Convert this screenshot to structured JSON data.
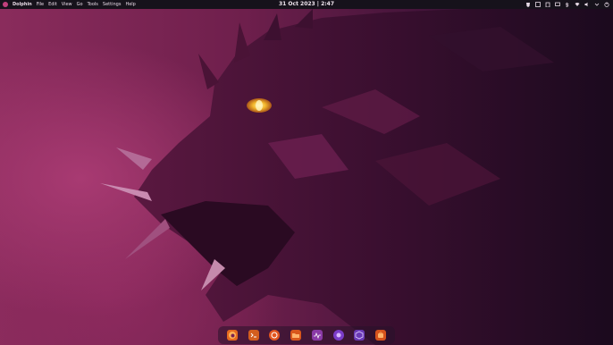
{
  "panel": {
    "app_name": "Dolphin",
    "menu": [
      "File",
      "Edit",
      "View",
      "Go",
      "Tools",
      "Settings",
      "Help"
    ],
    "clock": "31 Oct 2023 | 2:47"
  },
  "tray_icons": [
    "brave-lion-icon",
    "window-icon",
    "clipboard-icon",
    "network-icon",
    "bluetooth-icon",
    "wifi-icon",
    "volume-icon",
    "chevron-down-icon",
    "power-icon"
  ],
  "dock": {
    "apps": [
      {
        "name": "firefox-icon",
        "color": "#e66a1f"
      },
      {
        "name": "terminal-icon",
        "color": "#d35e1e"
      },
      {
        "name": "ubuntu-icon",
        "color": "#e2561f"
      },
      {
        "name": "files-icon",
        "color": "#d8571c"
      },
      {
        "name": "system-monitor-icon",
        "color": "#8a3aa6"
      },
      {
        "name": "proton-icon",
        "color": "#7b3cc9"
      },
      {
        "name": "cube-icon",
        "color": "#6a39b5"
      },
      {
        "name": "software-store-icon",
        "color": "#d6521c"
      }
    ]
  },
  "colors": {
    "panel_bg": "#16121b",
    "wallpaper_primary": "#8a2c5c",
    "dragon_eye": "#f2b62a"
  }
}
